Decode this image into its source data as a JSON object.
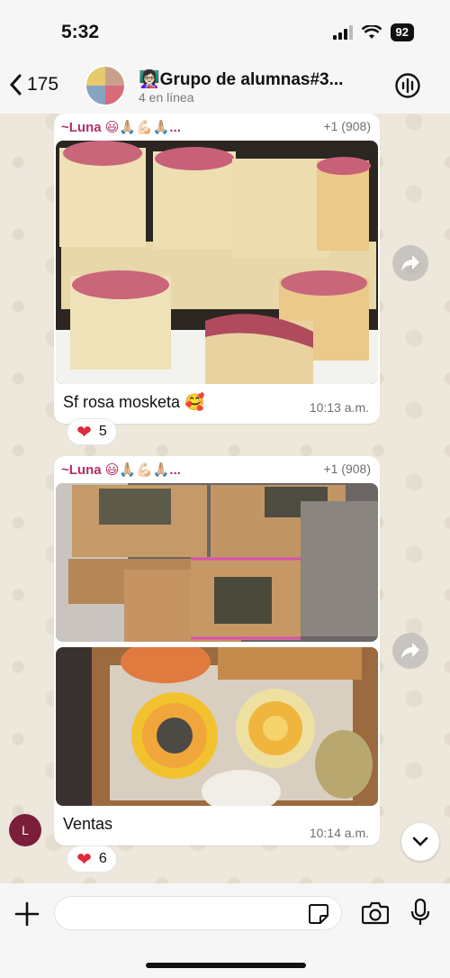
{
  "status": {
    "time": "5:32",
    "battery": "92"
  },
  "header": {
    "back_count": "175",
    "title": "Grupo de alumnas#3...",
    "subtitle": "4 en línea"
  },
  "messages": [
    {
      "sender": "~Luna 😃🙏🏼💪🏻🙏🏼...",
      "phone": "+1 (908)",
      "caption": "Sf rosa mosketa 🥰",
      "time": "10:13 a.m.",
      "reaction_emoji": "❤",
      "reaction_count": "5"
    },
    {
      "sender": "~Luna 😃🙏🏼💪🏻🙏🏼...",
      "phone": "+1 (908)",
      "caption": "Ventas",
      "time": "10:14 a.m.",
      "reaction_emoji": "❤",
      "reaction_count": "6"
    }
  ],
  "user_initial": "L",
  "composer": {
    "placeholder": ""
  }
}
